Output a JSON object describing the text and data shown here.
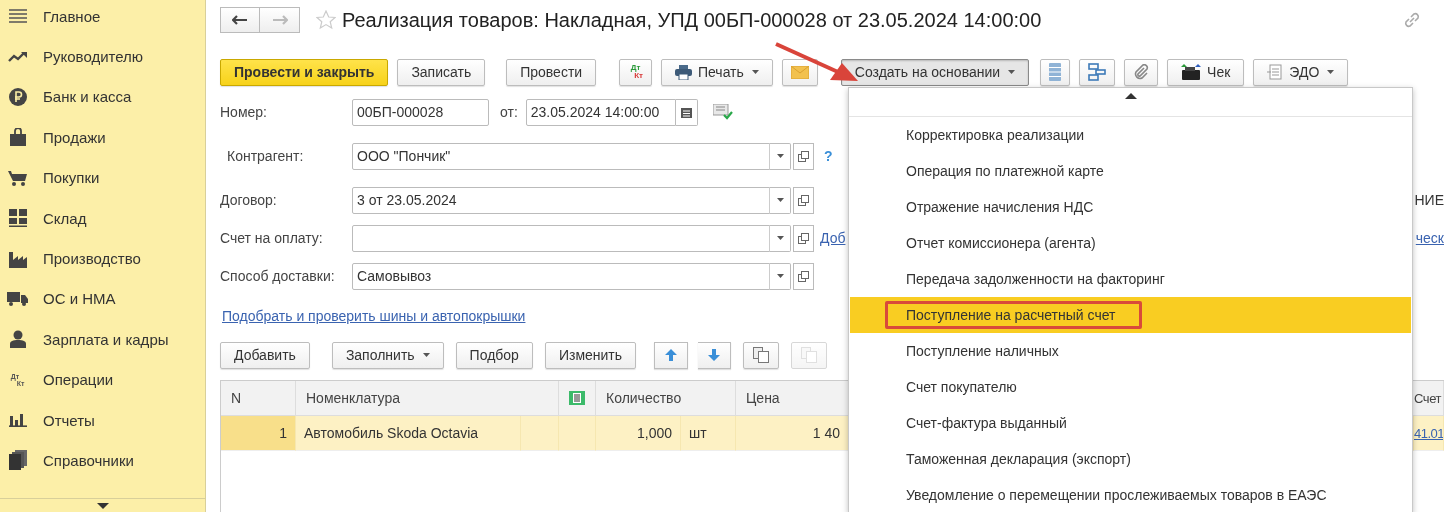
{
  "sidebar": {
    "items": [
      {
        "label": "Главное",
        "kind": "menu"
      },
      {
        "label": "Руководителю",
        "kind": "trend"
      },
      {
        "label": "Банк и касса",
        "kind": "coin"
      },
      {
        "label": "Продажи",
        "kind": "bag"
      },
      {
        "label": "Покупки",
        "kind": "cart"
      },
      {
        "label": "Склад",
        "kind": "grid"
      },
      {
        "label": "Производство",
        "kind": "factory"
      },
      {
        "label": "ОС и НМА",
        "kind": "truck"
      },
      {
        "label": "Зарплата и кадры",
        "kind": "person"
      },
      {
        "label": "Операции",
        "kind": "dtkt",
        "icon_text": [
          "Дт",
          "Кт"
        ]
      },
      {
        "label": "Отчеты",
        "kind": "bars"
      },
      {
        "label": "Справочники",
        "kind": "books"
      }
    ]
  },
  "title": "Реализация товаров: Накладная, УПД 00БП-000028 от 23.05.2024 14:00:00",
  "toolbar": [
    {
      "kind": "primary",
      "label": "Провести и закрыть"
    },
    {
      "kind": "text",
      "label": "Записать"
    },
    {
      "kind": "text",
      "label": "Провести"
    },
    {
      "kind": "dtkt",
      "icon_text": [
        "Дт",
        "Кт"
      ]
    },
    {
      "kind": "printer",
      "label": "Печать",
      "dropdown": true
    },
    {
      "kind": "envelope"
    },
    {
      "kind": "text",
      "label": "Создать на основании",
      "dropdown": true,
      "pressed": true
    },
    {
      "kind": "list"
    },
    {
      "kind": "structure"
    },
    {
      "kind": "clip"
    },
    {
      "kind": "register",
      "label": "Чек"
    },
    {
      "kind": "edo",
      "label": "ЭДО",
      "dropdown": true
    }
  ],
  "form": {
    "number": {
      "label": "Номер:",
      "value": "00БП-000028"
    },
    "date": {
      "label": "от:",
      "value": "23.05.2024 14:00:00"
    },
    "fields": [
      {
        "label": "Контрагент:",
        "value": "ООО \"Пончик\"",
        "help": "?"
      },
      {
        "label": "Договор:",
        "value": "3 от 23.05.2024",
        "aside": "НИЕ"
      },
      {
        "label": "Счет на оплату:",
        "link": "Доб",
        "aside_link": "ческ"
      },
      {
        "label": "Способ доставки:",
        "value": "Самовывоз"
      }
    ],
    "link": "Подобрать и проверить шины и автопокрышки"
  },
  "table_toolbar": [
    {
      "kind": "text",
      "label": "Добавить"
    },
    {
      "kind": "text",
      "label": "Заполнить",
      "dropdown": true
    },
    {
      "kind": "text",
      "label": "Подбор"
    },
    {
      "kind": "text",
      "label": "Изменить"
    },
    {
      "kind": "updown"
    },
    {
      "kind": "copy"
    },
    {
      "kind": "paste",
      "disabled": true
    }
  ],
  "table": {
    "columns": {
      "n": "N",
      "item": "Номенклатура",
      "quantity": "Количество",
      "price": "Цена",
      "account": "Счет"
    },
    "rows": [
      {
        "selected": true,
        "n": "1",
        "item": "Автомобиль Skoda Octavia",
        "quantity": "1,000",
        "unit": "шт",
        "price": "1 40",
        "account": "41.01"
      }
    ]
  },
  "menu": {
    "items": [
      {
        "label": "Корректировка реализации",
        "selected": false
      },
      {
        "label": "Операция по платежной карте",
        "selected": false
      },
      {
        "label": "Отражение начисления НДС",
        "selected": false
      },
      {
        "label": "Отчет комиссионера (агента)",
        "selected": false
      },
      {
        "label": "Передача задолженности на факторинг",
        "selected": false
      },
      {
        "label": "Поступление на расчетный счет",
        "selected": true,
        "callout": true
      },
      {
        "label": "Поступление наличных",
        "selected": false
      },
      {
        "label": "Счет покупателю",
        "selected": false
      },
      {
        "label": "Счет-фактура выданный",
        "selected": false
      },
      {
        "label": "Таможенная декларация (экспорт)",
        "selected": false
      },
      {
        "label": "Уведомление о перемещении прослеживаемых товаров в ЕАЭС",
        "selected": false
      }
    ]
  }
}
